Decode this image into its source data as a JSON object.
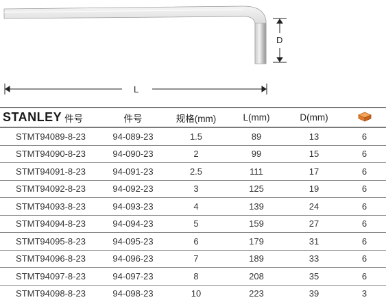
{
  "diagram": {
    "length_label": "L",
    "height_label": "D"
  },
  "table": {
    "brand": "STANLEY",
    "headers": [
      "件号",
      "件号",
      "规格(mm)",
      "L(mm)",
      "D(mm)"
    ],
    "pack_icon": "box-icon",
    "rows": [
      [
        "STMT94089-8-23",
        "94-089-23",
        "1.5",
        "89",
        "13",
        "6"
      ],
      [
        "STMT94090-8-23",
        "94-090-23",
        "2",
        "99",
        "15",
        "6"
      ],
      [
        "STMT94091-8-23",
        "94-091-23",
        "2.5",
        "111",
        "17",
        "6"
      ],
      [
        "STMT94092-8-23",
        "94-092-23",
        "3",
        "125",
        "19",
        "6"
      ],
      [
        "STMT94093-8-23",
        "94-093-23",
        "4",
        "139",
        "24",
        "6"
      ],
      [
        "STMT94094-8-23",
        "94-094-23",
        "5",
        "159",
        "27",
        "6"
      ],
      [
        "STMT94095-8-23",
        "94-095-23",
        "6",
        "179",
        "31",
        "6"
      ],
      [
        "STMT94096-8-23",
        "94-096-23",
        "7",
        "189",
        "33",
        "6"
      ],
      [
        "STMT94097-8-23",
        "94-097-23",
        "8",
        "208",
        "35",
        "6"
      ],
      [
        "STMT94098-8-23",
        "94-098-23",
        "10",
        "223",
        "39",
        "3"
      ]
    ]
  }
}
